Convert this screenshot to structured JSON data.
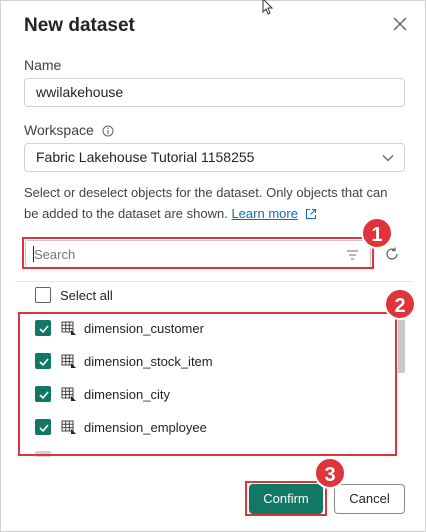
{
  "dialog": {
    "title": "New dataset",
    "close_icon": "close-icon"
  },
  "name_field": {
    "label": "Name",
    "value": "wwilakehouse"
  },
  "workspace_field": {
    "label": "Workspace",
    "info_icon": "info-icon",
    "value": "Fabric Lakehouse Tutorial 1158255",
    "dropdown_icon": "chevron-down-icon"
  },
  "description": {
    "text": "Select or deselect objects for the dataset. Only objects that can be added to the dataset are shown.",
    "link_label": "Learn more",
    "link_icon": "external-link-icon"
  },
  "search": {
    "placeholder": "Search",
    "filter_icon": "filter-icon",
    "refresh_icon": "refresh-icon"
  },
  "select_all": {
    "label": "Select all",
    "checked": false
  },
  "tables": [
    {
      "name": "dimension_customer",
      "checked": true,
      "icon": "table-icon"
    },
    {
      "name": "dimension_stock_item",
      "checked": true,
      "icon": "table-icon"
    },
    {
      "name": "dimension_city",
      "checked": true,
      "icon": "table-icon"
    },
    {
      "name": "dimension_employee",
      "checked": true,
      "icon": "table-icon"
    }
  ],
  "footer": {
    "confirm_label": "Confirm",
    "cancel_label": "Cancel"
  },
  "callouts": [
    {
      "number": "1"
    },
    {
      "number": "2"
    },
    {
      "number": "3"
    }
  ],
  "colors": {
    "accent": "#117865",
    "callout": "#e0343b",
    "link": "#0f6cbd"
  }
}
